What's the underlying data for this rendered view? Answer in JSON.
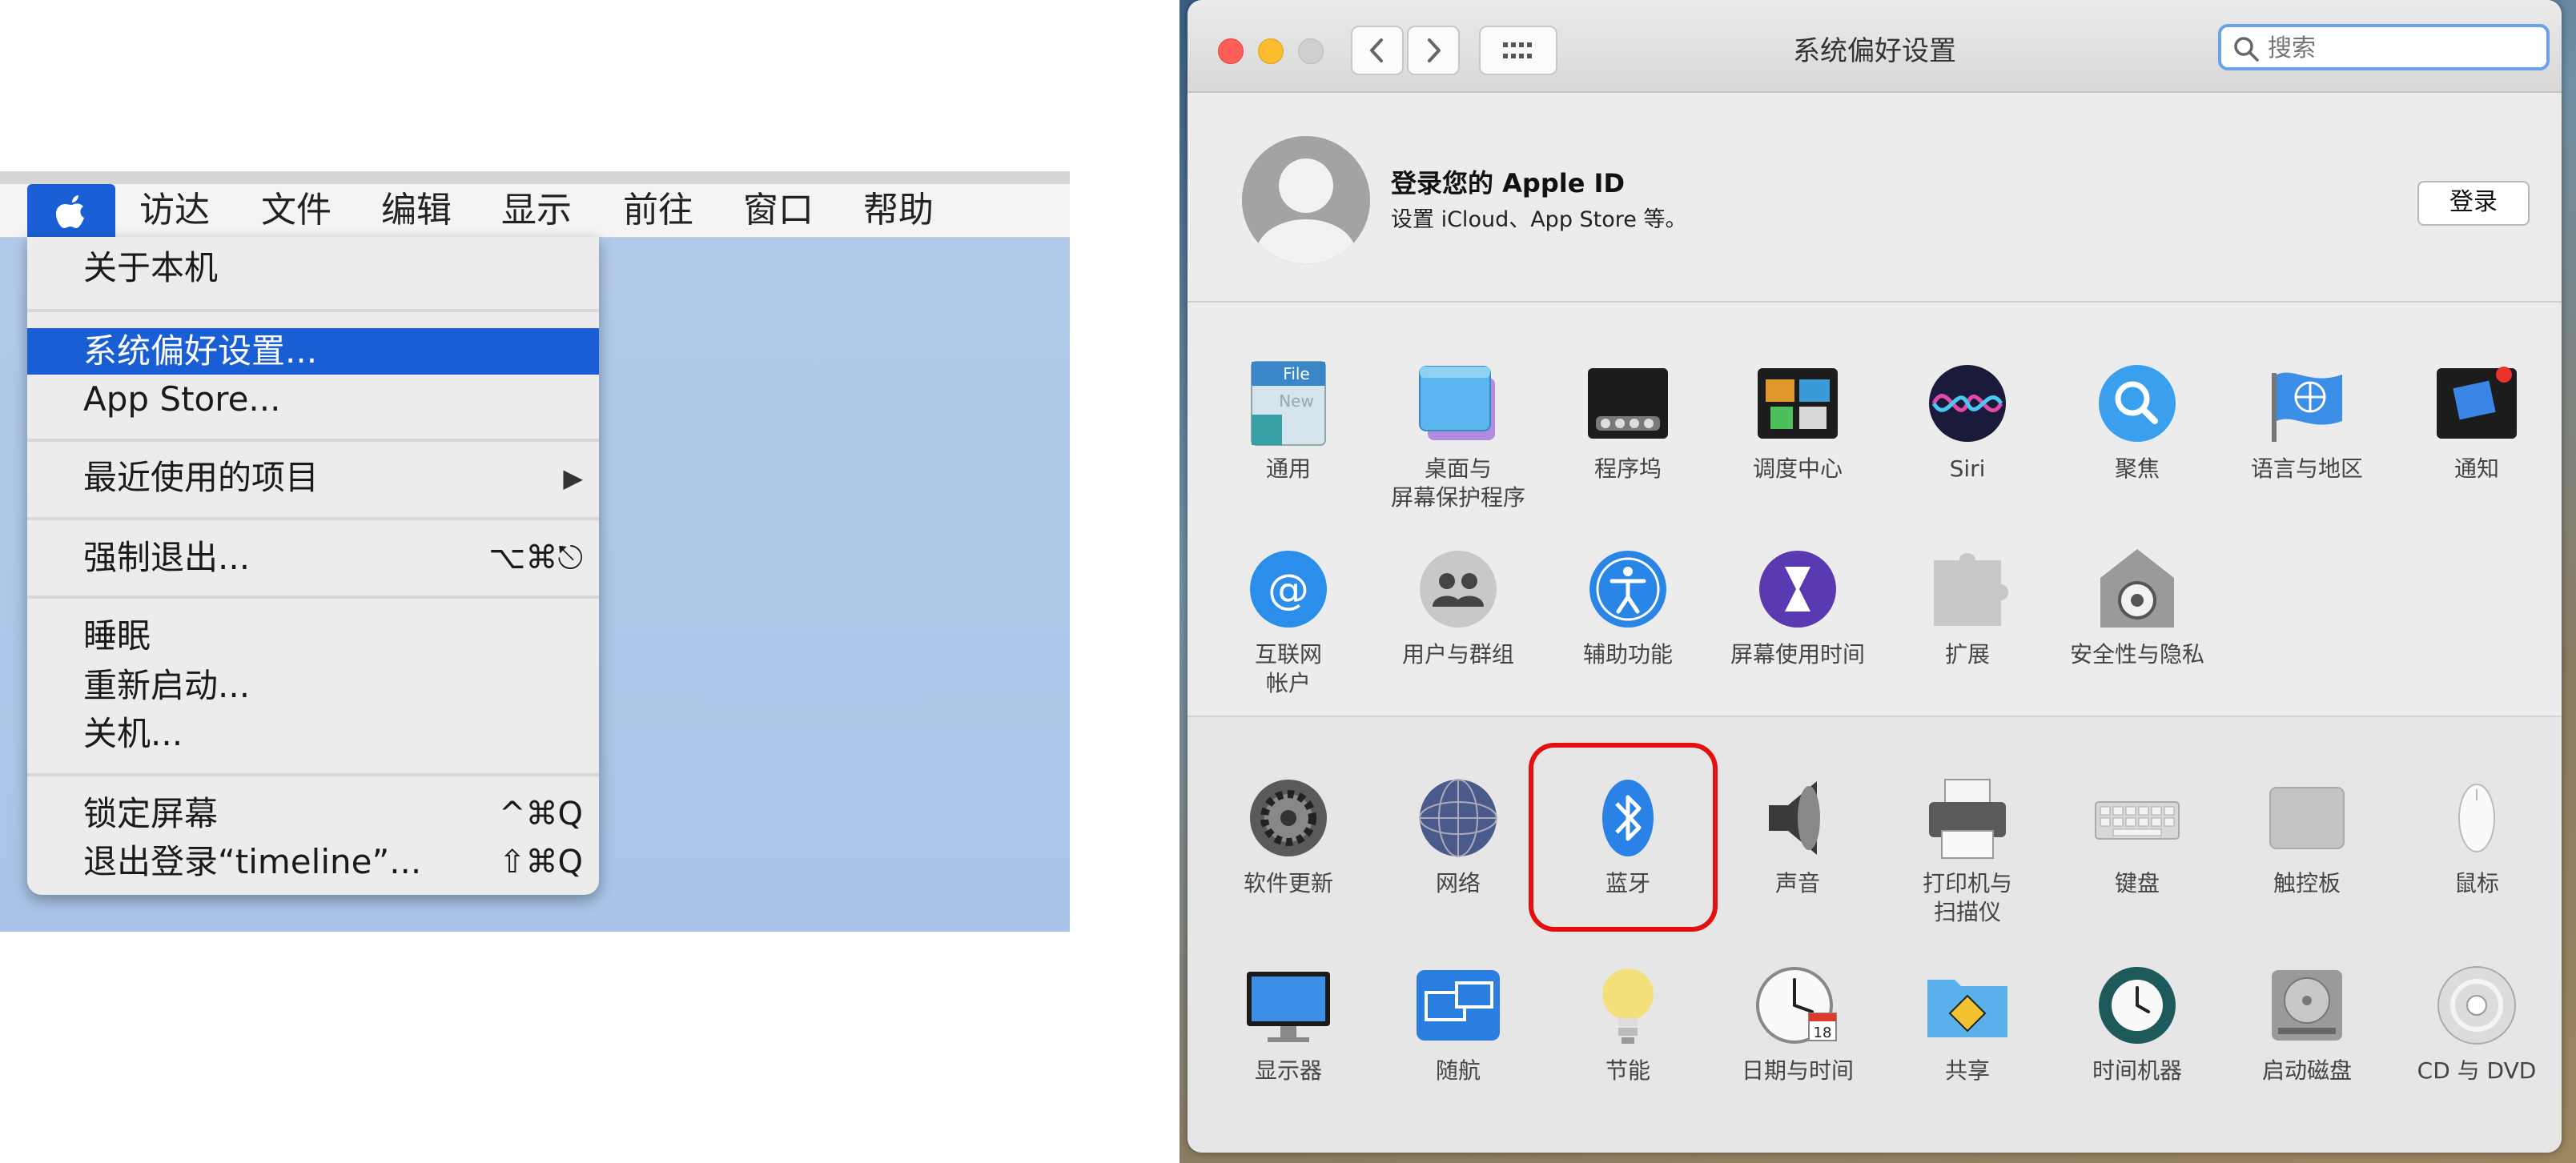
{
  "menubar": {
    "items": [
      "访达",
      "文件",
      "编辑",
      "显示",
      "前往",
      "窗口",
      "帮助"
    ]
  },
  "apple_menu": {
    "items": [
      {
        "label": "关于本机",
        "shortcut": ""
      },
      {
        "label": "系统偏好设置...",
        "shortcut": "",
        "selected": true
      },
      {
        "label": "App Store...",
        "shortcut": ""
      },
      {
        "label": "最近使用的项目",
        "shortcut": "▶"
      },
      {
        "label": "强制退出...",
        "shortcut": "⌥⌘⎋"
      },
      {
        "label": "睡眠",
        "shortcut": ""
      },
      {
        "label": "重新启动...",
        "shortcut": ""
      },
      {
        "label": "关机...",
        "shortcut": ""
      },
      {
        "label": "锁定屏幕",
        "shortcut": "^⌘Q"
      },
      {
        "label": "退出登录“timeline”...",
        "shortcut": "⇧⌘Q"
      }
    ]
  },
  "window": {
    "title": "系统偏好设置",
    "search_placeholder": "搜索"
  },
  "appleid": {
    "title": "登录您的 Apple ID",
    "subtitle": "设置 iCloud、App Store 等。",
    "login_label": "登录"
  },
  "prefs_top": [
    {
      "label": "通用",
      "icon": "general-icon"
    },
    {
      "label": "桌面与\n屏幕保护程序",
      "icon": "desktop-screensaver-icon"
    },
    {
      "label": "程序坞",
      "icon": "dock-icon"
    },
    {
      "label": "调度中心",
      "icon": "mission-control-icon"
    },
    {
      "label": "Siri",
      "icon": "siri-icon"
    },
    {
      "label": "聚焦",
      "icon": "spotlight-icon"
    },
    {
      "label": "语言与地区",
      "icon": "language-region-icon"
    },
    {
      "label": "通知",
      "icon": "notifications-icon"
    },
    {
      "label": "互联网\n帐户",
      "icon": "internet-accounts-icon"
    },
    {
      "label": "用户与群组",
      "icon": "users-groups-icon"
    },
    {
      "label": "辅助功能",
      "icon": "accessibility-icon"
    },
    {
      "label": "屏幕使用时间",
      "icon": "screen-time-icon"
    },
    {
      "label": "扩展",
      "icon": "extensions-icon"
    },
    {
      "label": "安全性与隐私",
      "icon": "security-privacy-icon"
    }
  ],
  "prefs_bottom": [
    {
      "label": "软件更新",
      "icon": "software-update-icon"
    },
    {
      "label": "网络",
      "icon": "network-icon"
    },
    {
      "label": "蓝牙",
      "icon": "bluetooth-icon",
      "highlighted": true
    },
    {
      "label": "声音",
      "icon": "sound-icon"
    },
    {
      "label": "打印机与\n扫描仪",
      "icon": "printers-scanners-icon"
    },
    {
      "label": "键盘",
      "icon": "keyboard-icon"
    },
    {
      "label": "触控板",
      "icon": "trackpad-icon"
    },
    {
      "label": "鼠标",
      "icon": "mouse-icon"
    },
    {
      "label": "显示器",
      "icon": "displays-icon"
    },
    {
      "label": "随航",
      "icon": "sidecar-icon"
    },
    {
      "label": "节能",
      "icon": "energy-saver-icon"
    },
    {
      "label": "日期与时间",
      "icon": "date-time-icon"
    },
    {
      "label": "共享",
      "icon": "sharing-icon"
    },
    {
      "label": "时间机器",
      "icon": "time-machine-icon"
    },
    {
      "label": "启动磁盘",
      "icon": "startup-disk-icon"
    },
    {
      "label": "CD 与 DVD",
      "icon": "cd-dvd-icon"
    }
  ],
  "colors": {
    "menu_highlight": "#1a5ed5",
    "highlight_border": "#e21010",
    "close": "#fd5f57",
    "minimize": "#fdbc2e",
    "zoom_disabled": "#cfcfcf"
  }
}
